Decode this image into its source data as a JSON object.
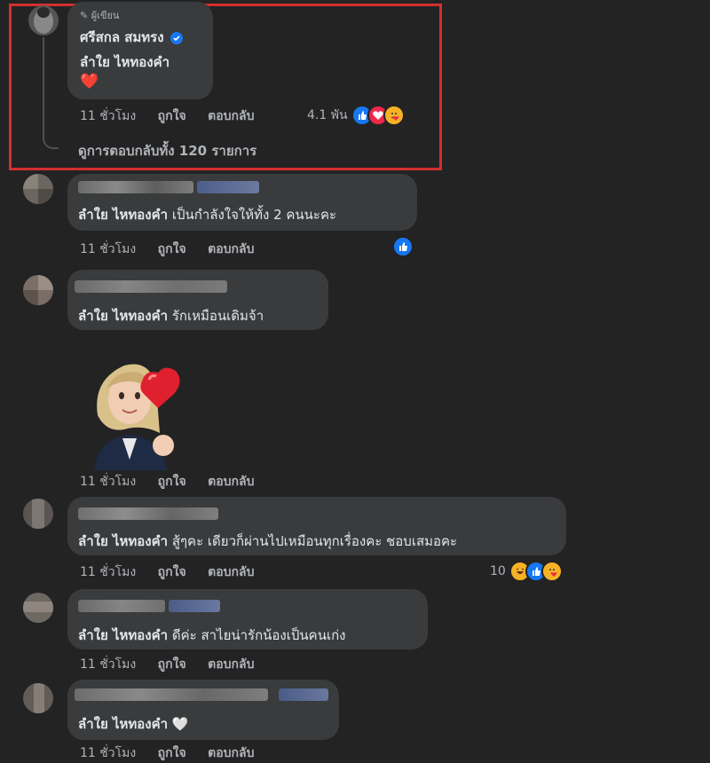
{
  "author_comment": {
    "author_badge": "ผู้เขียน",
    "name": "ศรีสกล สมทรง",
    "text": "ลำใย ไหทองคำ",
    "emoji": "❤️",
    "time": "11 ชั่วโมง",
    "like": "ถูกใจ",
    "reply": "ตอบกลับ",
    "reaction_count": "4.1 พัน",
    "view_replies": "ดูการตอบกลับทั้ง 120 รายการ"
  },
  "highlight_color": "#d32f2f",
  "comments": [
    {
      "mention": "ลำใย ไหทองคำ",
      "text": "เป็นกำลังใจให้ทั้ง 2 คนนะคะ",
      "time": "11 ชั่วโมง",
      "like": "ถูกใจ",
      "reply": "ตอบกลับ"
    },
    {
      "mention": "ลำใย ไหทองคำ",
      "text": "รักเหมือนเดิมจ้า",
      "time": "11 ชั่วโมง",
      "like": "ถูกใจ",
      "reply": "ตอบกลับ"
    },
    {
      "mention": "ลำใย ไหทองคำ",
      "text": "สู้ๆคะ เดียวก็ผ่านไปเหมือนทุกเรื่องคะ ชอบเสมอคะ",
      "time": "11 ชั่วโมง",
      "like": "ถูกใจ",
      "reply": "ตอบกลับ",
      "reaction_count": "10"
    },
    {
      "mention": "ลำใย ไหทองคำ",
      "text": "ดีค่ะ สาไยน่ารักน้องเป็นคนเก่ง",
      "time": "11 ชั่วโมง",
      "like": "ถูกใจ",
      "reply": "ตอบกลับ"
    },
    {
      "mention": "ลำใย ไหทองคำ",
      "text": "🤍",
      "time": "11 ชั่วโมง",
      "like": "ถูกใจ",
      "reply": "ตอบกลับ"
    }
  ],
  "sticker_meta": {
    "time": "11 ชั่วโมง",
    "like": "ถูกใจ",
    "reply": "ตอบกลับ"
  },
  "icons": [
    "pencil-icon",
    "verified-badge-icon",
    "like-reaction-icon",
    "love-reaction-icon",
    "care-reaction-icon",
    "haha-reaction-icon"
  ]
}
